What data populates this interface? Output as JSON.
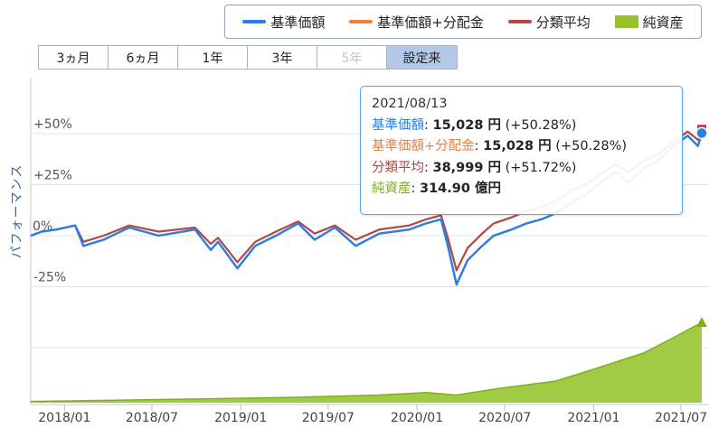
{
  "legend": [
    {
      "label": "基準価額",
      "color": "#2a7ee4",
      "kind": "line"
    },
    {
      "label": "基準価額+分配金",
      "color": "#f07f3c",
      "kind": "line"
    },
    {
      "label": "分類平均",
      "color": "#b04848",
      "kind": "line"
    },
    {
      "label": "純資産",
      "color": "#94c22b",
      "kind": "area"
    }
  ],
  "ranges": [
    {
      "label": "3ヵ月",
      "state": "normal"
    },
    {
      "label": "6ヵ月",
      "state": "normal"
    },
    {
      "label": "1年",
      "state": "normal"
    },
    {
      "label": "3年",
      "state": "normal"
    },
    {
      "label": "5年",
      "state": "disabled"
    },
    {
      "label": "設定来",
      "state": "active"
    }
  ],
  "y_axis_title": "パフォーマンス",
  "tooltip": {
    "date": "2021/08/13",
    "nav_label": "基準価額",
    "nav_value": "15,028 円",
    "nav_pct": "(+50.28%)",
    "dist_label": "基準価額+分配金",
    "dist_value": "15,028 円",
    "dist_pct": "(+50.28%)",
    "avg_label": "分類平均",
    "avg_value": "38,999 円",
    "avg_pct": "(+51.72%)",
    "assets_label": "純資産",
    "assets_value": "314.90 億円"
  },
  "chart_data": {
    "type": "line",
    "x_tick_labels": [
      "2018/01",
      "2018/07",
      "2019/01",
      "2019/07",
      "2020/01",
      "2020/07",
      "2021/01",
      "2021/07"
    ],
    "x_range": [
      "2017-10-23",
      "2021-08-13"
    ],
    "y_tick_labels": [
      "+50%",
      "+25%",
      "0%",
      "-25%"
    ],
    "ylim": [
      -25,
      50
    ],
    "colors": {
      "nav": "#2a7ee4",
      "dist": "#f07f3c",
      "avg": "#b04848",
      "assets_fill": "#9cc83a",
      "assets_line": "#7fb01c"
    },
    "series": [
      {
        "name": "基準価額",
        "x": [
          "2017-10-23",
          "2017-11-15",
          "2017-12-15",
          "2018-01-23",
          "2018-02-09",
          "2018-03-23",
          "2018-05-15",
          "2018-07-15",
          "2018-09-28",
          "2018-10-31",
          "2018-11-15",
          "2018-12-25",
          "2019-01-31",
          "2019-03-15",
          "2019-04-30",
          "2019-06-03",
          "2019-07-15",
          "2019-08-27",
          "2019-10-15",
          "2019-12-16",
          "2020-01-20",
          "2020-02-20",
          "2020-03-05",
          "2020-03-23",
          "2020-04-15",
          "2020-05-15",
          "2020-06-08",
          "2020-07-15",
          "2020-08-15",
          "2020-09-15",
          "2020-10-15",
          "2020-11-15",
          "2020-12-15",
          "2021-01-15",
          "2021-02-15",
          "2021-03-15",
          "2021-04-15",
          "2021-05-15",
          "2021-06-15",
          "2021-07-15",
          "2021-08-05",
          "2021-08-13"
        ],
        "values": [
          0,
          2,
          3,
          5,
          -5,
          -2,
          4,
          0,
          3,
          -7,
          -3,
          -16,
          -5,
          0,
          6,
          -2,
          4,
          -5,
          1,
          3,
          6,
          8,
          -5,
          -24,
          -12,
          -5,
          0,
          3,
          6,
          8,
          11,
          16,
          20,
          26,
          31,
          26,
          33,
          37,
          44,
          49,
          44,
          50.28
        ]
      },
      {
        "name": "基準価額+分配金",
        "x": [
          "2017-10-23",
          "2017-11-15",
          "2017-12-15",
          "2018-01-23",
          "2018-02-09",
          "2018-03-23",
          "2018-05-15",
          "2018-07-15",
          "2018-09-28",
          "2018-10-31",
          "2018-11-15",
          "2018-12-25",
          "2019-01-31",
          "2019-03-15",
          "2019-04-30",
          "2019-06-03",
          "2019-07-15",
          "2019-08-27",
          "2019-10-15",
          "2019-12-16",
          "2020-01-20",
          "2020-02-20",
          "2020-03-05",
          "2020-03-23",
          "2020-04-15",
          "2020-05-15",
          "2020-06-08",
          "2020-07-15",
          "2020-08-15",
          "2020-09-15",
          "2020-10-15",
          "2020-11-15",
          "2020-12-15",
          "2021-01-15",
          "2021-02-15",
          "2021-03-15",
          "2021-04-15",
          "2021-05-15",
          "2021-06-15",
          "2021-07-15",
          "2021-08-05",
          "2021-08-13"
        ],
        "values": [
          0,
          2,
          3,
          5,
          -5,
          -2,
          4,
          0,
          3,
          -7,
          -3,
          -16,
          -5,
          0,
          6,
          -2,
          4,
          -5,
          1,
          3,
          6,
          8,
          -5,
          -24,
          -12,
          -5,
          0,
          3,
          6,
          8,
          11,
          16,
          20,
          26,
          31,
          26,
          33,
          37,
          44,
          49,
          44,
          50.28
        ]
      },
      {
        "name": "分類平均",
        "x": [
          "2017-10-23",
          "2017-11-15",
          "2017-12-15",
          "2018-01-23",
          "2018-02-09",
          "2018-03-23",
          "2018-05-15",
          "2018-07-15",
          "2018-09-28",
          "2018-10-31",
          "2018-11-15",
          "2018-12-25",
          "2019-01-31",
          "2019-03-15",
          "2019-04-30",
          "2019-06-03",
          "2019-07-15",
          "2019-08-27",
          "2019-10-15",
          "2019-12-16",
          "2020-01-20",
          "2020-02-20",
          "2020-03-05",
          "2020-03-23",
          "2020-04-15",
          "2020-05-15",
          "2020-06-08",
          "2020-07-15",
          "2020-08-15",
          "2020-09-15",
          "2020-10-15",
          "2020-11-15",
          "2020-12-15",
          "2021-01-15",
          "2021-02-15",
          "2021-03-15",
          "2021-04-15",
          "2021-05-15",
          "2021-06-15",
          "2021-07-15",
          "2021-08-05",
          "2021-08-13"
        ],
        "values": [
          0,
          2,
          3,
          5,
          -3,
          0,
          5,
          2,
          4,
          -4,
          -1,
          -13,
          -3,
          2,
          7,
          1,
          5,
          -2,
          3,
          5,
          8,
          10,
          -1,
          -17,
          -6,
          1,
          6,
          9,
          12,
          14,
          17,
          22,
          25,
          30,
          35,
          31,
          37,
          40,
          46,
          51,
          47,
          51.72
        ]
      }
    ],
    "assets_series": {
      "name": "純資産",
      "x": [
        "2017-10-23",
        "2018-04-15",
        "2018-10-15",
        "2019-04-15",
        "2019-10-15",
        "2020-01-20",
        "2020-03-23",
        "2020-06-15",
        "2020-10-15",
        "2021-01-15",
        "2021-04-15",
        "2021-06-15",
        "2021-08-13"
      ],
      "values": [
        5,
        10,
        15,
        21,
        30,
        40,
        30,
        55,
        85,
        140,
        195,
        255,
        314.9
      ],
      "ylim": [
        0,
        340
      ]
    }
  }
}
